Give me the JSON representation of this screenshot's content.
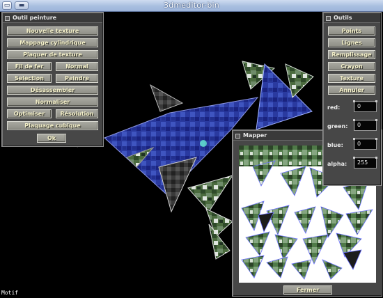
{
  "window": {
    "title": "3dmeditor-bin",
    "app_icon": "document-icon",
    "menu_icon": "window-menu-icon"
  },
  "status": {
    "mode": "Motif"
  },
  "outil_peinture": {
    "title": "Outil peinture",
    "buttons": {
      "nouvelle_texture": "Nouvelle texture",
      "mappage_cylindrique": "Mappage cylindrique",
      "plaquer_texture": "Plaquer de texture",
      "fil_de_fer": "Fil de fer",
      "normal": "Normal",
      "selection": "Selection",
      "peindre": "Peindre",
      "desassembler": "Désassembler",
      "normaliser": "Normaliser",
      "optimiser": "Optimiser",
      "resolution": "Résolution",
      "plaquage_cubique": "Plaquage cubique",
      "ok": "Ok"
    }
  },
  "outils": {
    "title": "Outils",
    "buttons": {
      "points": "Points",
      "lignes": "Lignes",
      "remplissage": "Remplissage",
      "crayon": "Crayon",
      "texture": "Texture",
      "annuler": "Annuler"
    },
    "color": {
      "red_label": "red:",
      "red_value": "0",
      "green_label": "green:",
      "green_value": "0",
      "blue_label": "blue:",
      "blue_value": "0",
      "alpha_label": "alpha:",
      "alpha_value": "255"
    }
  },
  "mapper": {
    "title": "Mapper",
    "close_label": "Fermer"
  },
  "colors": {
    "background": "#000000",
    "panel": "#474747",
    "button": "#9a9a92",
    "mesh_blue": "#1a2480",
    "mapper_bg": "#ffffff"
  }
}
